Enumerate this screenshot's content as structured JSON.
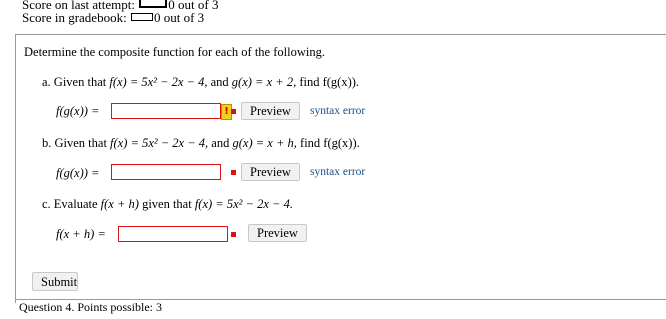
{
  "scores": {
    "last_attempt_label": "Score on last attempt:",
    "last_attempt_value": "0 out of 3",
    "gradebook_label": "Score in gradebook:",
    "gradebook_value": "0 out of 3"
  },
  "question": {
    "intro": "Determine the composite function for each of the following.",
    "parts": [
      {
        "label": "a. Given that",
        "f_def": "f(x) = 5x² − 2x − 4,",
        "and": "and",
        "g_def": "g(x) = x + 2,",
        "find": "find f(g(x)).",
        "lhs": "f(g(x)) =",
        "input_value": "",
        "preview_label": "Preview",
        "status": "syntax error"
      },
      {
        "label": "b. Given that",
        "f_def": "f(x) = 5x² − 2x − 4,",
        "and": "and",
        "g_def": "g(x) = x + h,",
        "find": "find f(g(x)).",
        "lhs": "f(g(x)) =",
        "input_value": "",
        "preview_label": "Preview",
        "status": "syntax error"
      },
      {
        "label": "c. Evaluate",
        "expr": "f(x + h)",
        "given": "given that",
        "f_def": "f(x) = 5x² − 2x − 4.",
        "lhs": "f(x + h) =",
        "input_value": "",
        "preview_label": "Preview"
      }
    ],
    "submit_label": "Submit"
  },
  "next": {
    "header": "Question 4. Points possible: 3"
  },
  "colors": {
    "error_border": "#dd1111",
    "warning_icon": "#f2cf1b",
    "link_blue": "#1a4f86"
  }
}
